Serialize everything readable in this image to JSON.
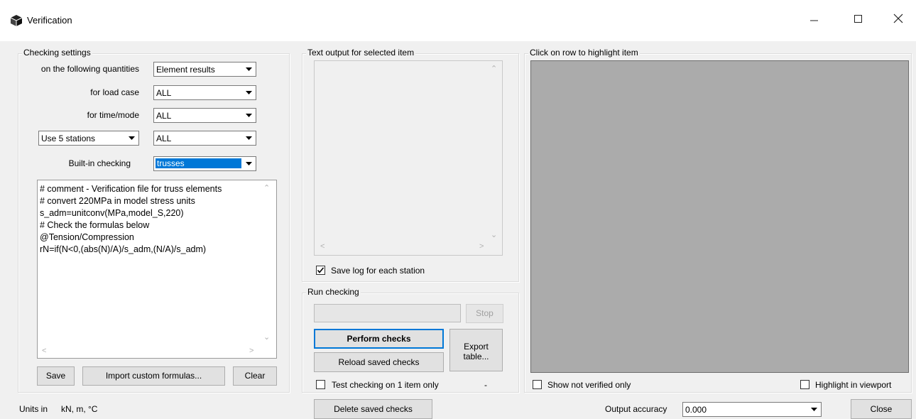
{
  "window": {
    "title": "Verification",
    "minimize_icon": "minimize-icon",
    "maximize_icon": "maximize-icon",
    "close_icon": "close-icon"
  },
  "checking_settings": {
    "group_label": "Checking settings",
    "quantities_label": "on  the following quantities",
    "quantities_value": "Element results",
    "load_case_label": "for load case",
    "load_case_value": "ALL",
    "time_mode_label": "for time/mode",
    "time_mode_value": "ALL",
    "stations_value": "Use 5 stations",
    "stations_filter_value": "ALL",
    "builtin_label": "Built-in checking",
    "builtin_value": "trusses",
    "formulas": [
      "# comment - Verification file for truss elements",
      "# convert 220MPa in model stress units",
      "s_adm=unitconv(MPa,model_S,220)",
      "# Check the formulas below",
      "@Tension/Compression",
      "rN=if(N<0,(abs(N)/A)/s_adm,(N/A)/s_adm)"
    ],
    "save_button": "Save",
    "import_button": "Import custom formulas...",
    "clear_button": "Clear"
  },
  "units": {
    "label": "Units in",
    "value": "kN, m, °C"
  },
  "text_output": {
    "group_label": "Text output for selected item",
    "save_log_label": "Save log for each station",
    "save_log_checked": true
  },
  "run_checking": {
    "group_label": "Run checking",
    "stop_button": "Stop",
    "perform_button": "Perform checks",
    "reload_button": "Reload saved checks",
    "export_button_line1": "Export",
    "export_button_line2": "table...",
    "test_label": "Test checking on 1 item only",
    "test_checked": false,
    "status_dash": "-"
  },
  "delete_button": "Delete saved checks",
  "results": {
    "group_label": "Click on row to highlight item",
    "show_not_verified_label": "Show not verified only",
    "highlight_label": "Highlight in viewport"
  },
  "output_accuracy": {
    "label": "Output accuracy",
    "value": "0.000"
  },
  "close_button": "Close"
}
